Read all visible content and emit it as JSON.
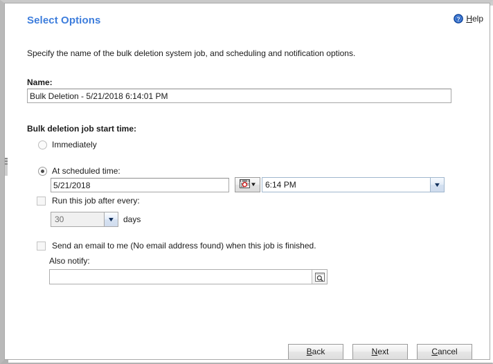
{
  "window": {
    "frame_color": "#b9b9b9",
    "background": "#ffffff"
  },
  "header": {
    "title": "Select Options",
    "title_color": "#3d7ddc",
    "help": {
      "icon": "help-circle-icon",
      "accelerator": "H",
      "rest": "elp",
      "full_label": "Help"
    }
  },
  "intro": {
    "text": "Specify the name of the bulk deletion system job, and scheduling and notification options."
  },
  "name_section": {
    "label": "Name:",
    "value": "Bulk Deletion - 5/21/2018 6:14:01 PM",
    "placeholder": ""
  },
  "schedule_section": {
    "label": "Bulk deletion job start time:",
    "options": [
      {
        "label": "Immediately",
        "selected": false
      },
      {
        "label": "At scheduled time:",
        "selected": true
      }
    ],
    "date": {
      "value": "5/21/2018",
      "placeholder": "",
      "picker_icon": "calendar-icon",
      "picker_chevron": "▼"
    },
    "time": {
      "value": "6:14 PM",
      "chevron": "▼"
    }
  },
  "recurrence_section": {
    "checkbox_label": "Run this job after every:",
    "checked": false,
    "interval_value": "30",
    "interval_chevron": "▼",
    "unit_label": "days"
  },
  "notification_section": {
    "email_checkbox_label": "Send an email to me (No email address found) when this job is finished.",
    "email_checked": false,
    "also_notify_label": "Also notify:",
    "also_notify_value": "",
    "also_notify_placeholder": "",
    "lookup_icon": "lookup-magnifier-icon"
  },
  "footer": {
    "buttons": [
      {
        "name": "back",
        "accelerator": "B",
        "rest": "ack",
        "full_label": "Back"
      },
      {
        "name": "next",
        "accelerator": "N",
        "rest": "ext",
        "full_label": "Next"
      },
      {
        "name": "cancel",
        "accelerator": "C",
        "rest": "ancel",
        "full_label": "Cancel"
      }
    ]
  }
}
